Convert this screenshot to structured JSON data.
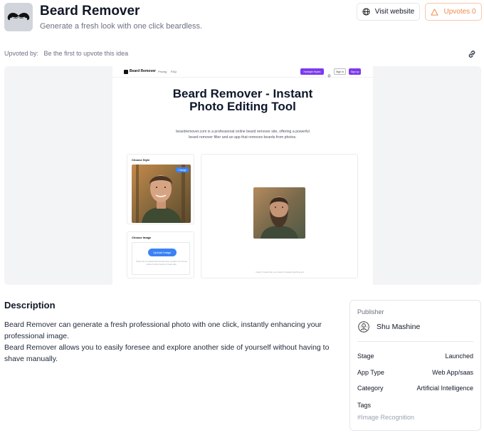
{
  "header": {
    "title": "Beard Remover",
    "tagline": "Generate a fresh look with one click beardless.",
    "logo_icon": "mustache-icon",
    "visit_label": "Visit website",
    "upvotes_label": "Upvotes 0",
    "upvote_color": "#f08a4b"
  },
  "upvoted": {
    "label": "Upvoted by:",
    "value": "Be the first to upvote this idea"
  },
  "preview": {
    "nav": {
      "brand": "Beard Remover",
      "links": [
        "Pricing",
        "FAQ"
      ],
      "hairstyles_label": "Hairstyle Styles",
      "signin_label": "Sign in",
      "signup_label": "Sign up"
    },
    "hero_title": "Beard Remover - Instant Photo Editing Tool",
    "hero_desc": "beardremover.com is a professional online beard remover site, offering a powerful beard remover filter and an app that removes beards from photos.",
    "choose_style_label": "Choose Style",
    "change_label": "Change",
    "choose_image_label": "Choose Image",
    "upload_label": "Upload Image",
    "upload_hint": "Photos do not upload that look like these numbers. Do not use photos of other people to create fake.",
    "result_caption": "Oops! It looks like you haven't created anything yet."
  },
  "description": {
    "title": "Description",
    "paragraphs": [
      "Beard Remover can generate a fresh professional photo with one click, instantly enhancing your professional image.",
      "Beard Remover allows you to easily foresee and explore another side of yourself without having to shave manually."
    ]
  },
  "publisher": {
    "label": "Publisher",
    "name": "Shu Mashine",
    "stage_label": "Stage",
    "stage_value": "Launched",
    "type_label": "App Type",
    "type_value": "Web App/saas",
    "category_label": "Category",
    "category_value": "Artificial Intelligence",
    "tags_label": "Tags",
    "tags": [
      "#Image Recognition"
    ]
  }
}
